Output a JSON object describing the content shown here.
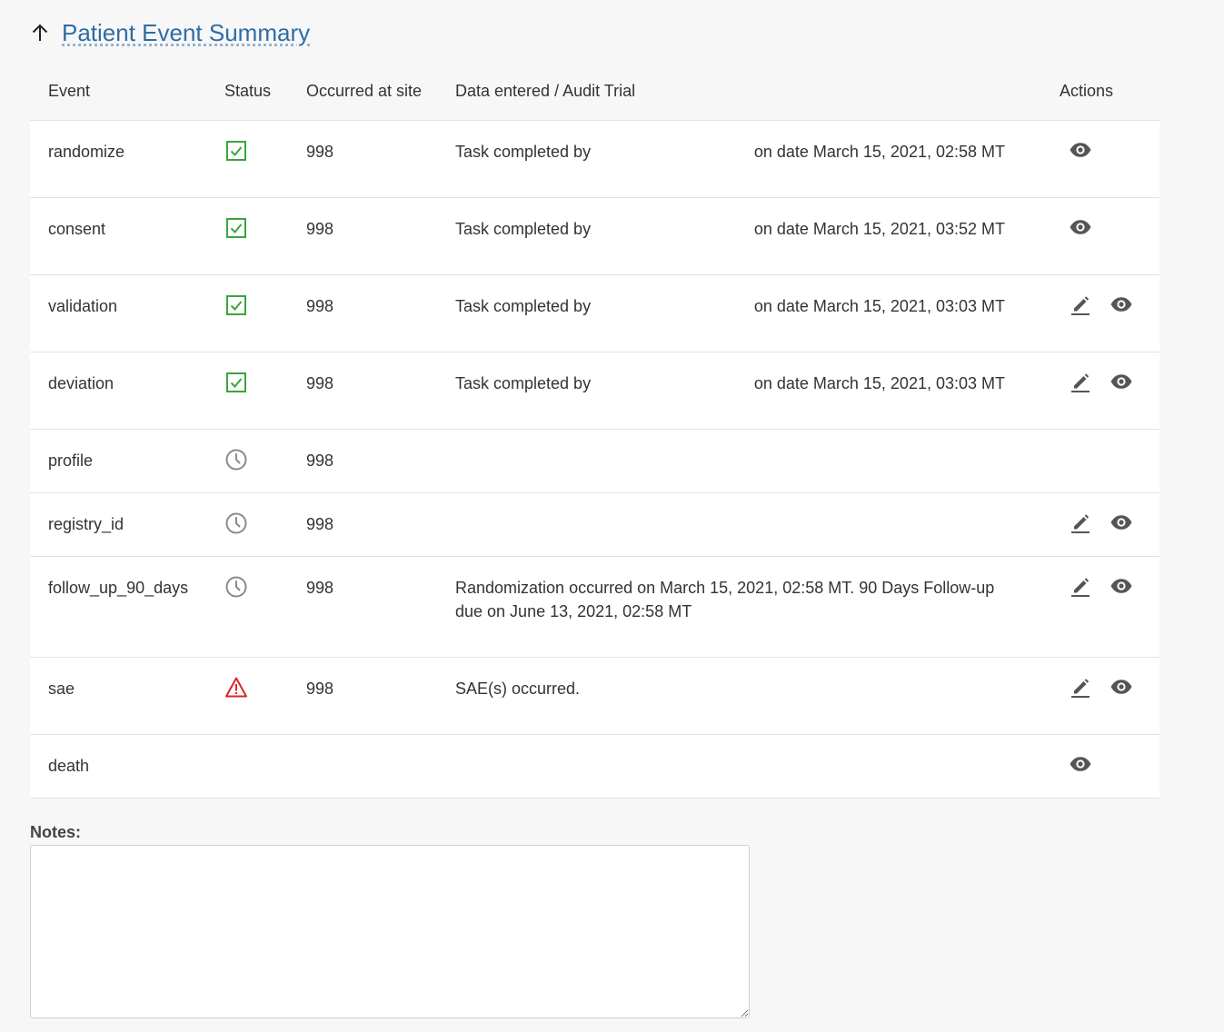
{
  "header": {
    "title": "Patient Event Summary",
    "back_icon": "arrow-up-icon"
  },
  "columns": {
    "event": "Event",
    "status": "Status",
    "site": "Occurred at site",
    "data": "Data entered / Audit Trial",
    "actions": "Actions"
  },
  "colors": {
    "link": "#2e6da4",
    "complete": "#3aa53a",
    "pending": "#8a8a8a",
    "warning": "#d9262c",
    "action": "#555555"
  },
  "rows": [
    {
      "event": "randomize",
      "status_icon": "checkbox-checked-icon",
      "site": "998",
      "data_left": "Task completed by",
      "data_right": "on date March 15, 2021, 02:58 MT",
      "actions": [
        "eye-icon"
      ]
    },
    {
      "event": "consent",
      "status_icon": "checkbox-checked-icon",
      "site": "998",
      "data_left": "Task completed by",
      "data_right": "on date March 15, 2021, 03:52 MT",
      "actions": [
        "eye-icon"
      ]
    },
    {
      "event": "validation",
      "status_icon": "checkbox-checked-icon",
      "site": "998",
      "data_left": "Task completed by",
      "data_right": "on date March 15, 2021, 03:03 MT",
      "actions": [
        "pencil-icon",
        "eye-icon"
      ]
    },
    {
      "event": "deviation",
      "status_icon": "checkbox-checked-icon",
      "site": "998",
      "data_left": "Task completed by",
      "data_right": "on date March 15, 2021, 03:03 MT",
      "actions": [
        "pencil-icon",
        "eye-icon"
      ]
    },
    {
      "event": "profile",
      "status_icon": "clock-icon",
      "site": "998",
      "data_left": "",
      "data_right": "",
      "actions": []
    },
    {
      "event": "registry_id",
      "status_icon": "clock-icon",
      "site": "998",
      "data_left": "",
      "data_right": "",
      "actions": [
        "pencil-icon",
        "eye-icon"
      ]
    },
    {
      "event": "follow_up_90_days",
      "status_icon": "clock-icon",
      "site": "998",
      "data_left": "Randomization occurred on March 15, 2021, 02:58 MT. 90 Days Follow-up due on June 13, 2021, 02:58 MT",
      "data_right": "",
      "actions": [
        "pencil-icon",
        "eye-icon"
      ]
    },
    {
      "event": "sae",
      "status_icon": "warning-triangle-icon",
      "site": "998",
      "data_left": "SAE(s) occurred.",
      "data_right": "",
      "actions": [
        "pencil-icon",
        "eye-icon"
      ]
    },
    {
      "event": "death",
      "status_icon": "",
      "site": "",
      "data_left": "",
      "data_right": "",
      "actions": [
        "eye-icon"
      ]
    }
  ],
  "notes": {
    "label": "Notes:",
    "value": ""
  }
}
